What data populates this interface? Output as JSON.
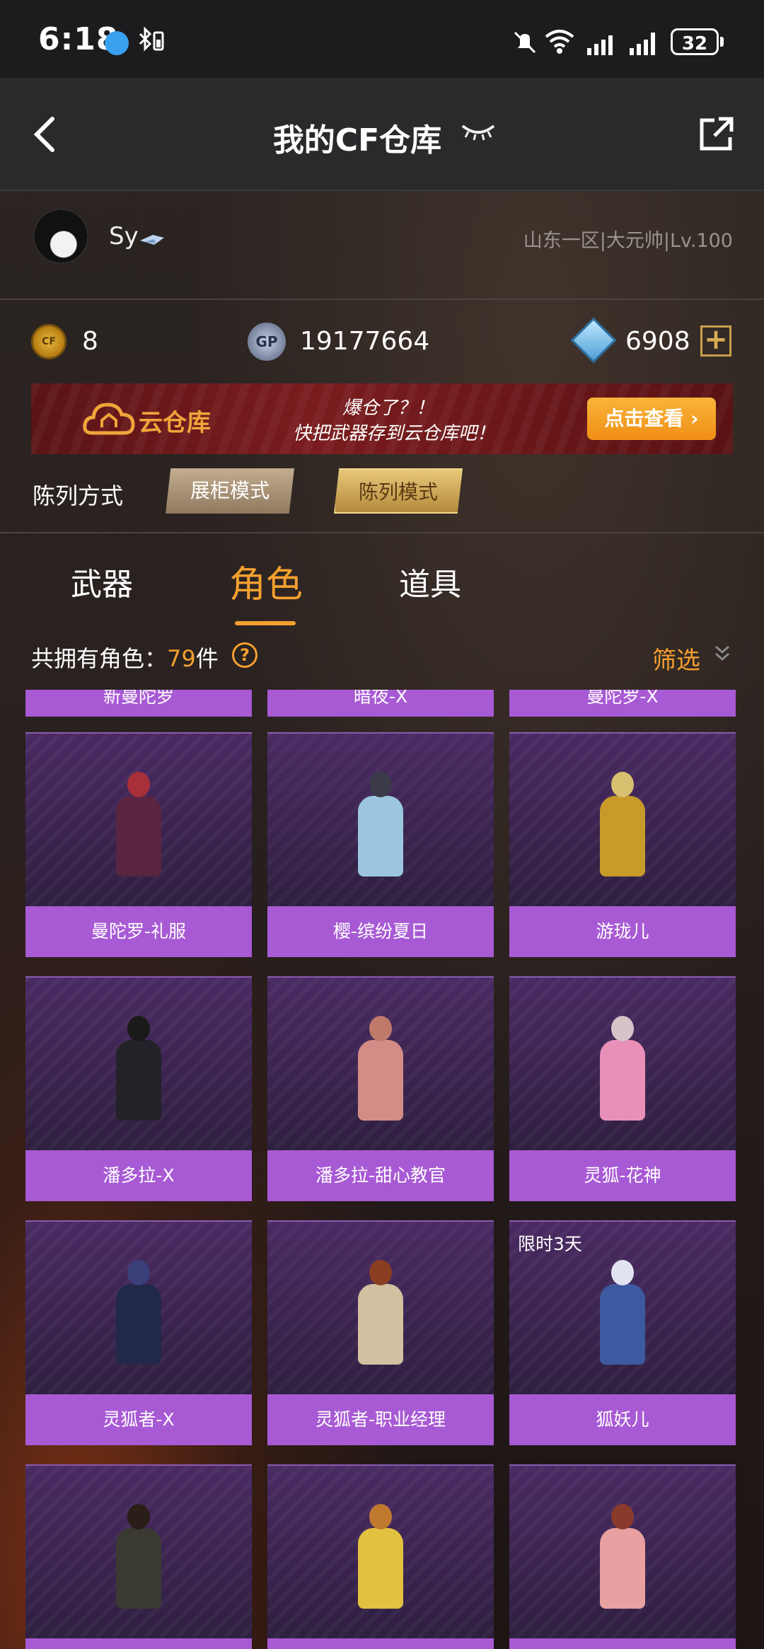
{
  "status_bar": {
    "time": "6:18",
    "battery": "32"
  },
  "header": {
    "title": "我的CF仓库"
  },
  "profile": {
    "username": "Sy",
    "server_info": "山东一区|大元帅|Lv.100"
  },
  "currencies": {
    "cf_points": "8",
    "gp": "19177664",
    "diamonds": "6908",
    "cf_icon_text": "CF",
    "gp_icon_text": "GP"
  },
  "banner": {
    "title": "云仓库",
    "slogan_1": "爆仓了？！",
    "slogan_2": "快把武器存到云仓库吧！",
    "button": "点击查看 ›"
  },
  "display_mode": {
    "label": "陈列方式",
    "options": [
      "展柜模式",
      "陈列模式"
    ],
    "selected": "陈列模式"
  },
  "tabs": [
    {
      "label": "武器"
    },
    {
      "label": "角色",
      "active": true
    },
    {
      "label": "道具"
    }
  ],
  "summary": {
    "prefix": "共拥有角色：",
    "count": "79",
    "suffix": "件",
    "help_icon": "?",
    "filter_label": "筛选"
  },
  "partial_top_row": [
    "新曼陀罗",
    "暗夜-X",
    "曼陀罗-X"
  ],
  "characters": [
    {
      "name": "曼陀罗-礼服",
      "hair": "#a8303a",
      "outfit": "#5a2540"
    },
    {
      "name": "樱-缤纷夏日",
      "hair": "#3a3a48",
      "outfit": "#9cc6e0"
    },
    {
      "name": "游珑儿",
      "hair": "#d8c070",
      "outfit": "#c79a2a"
    },
    {
      "name": "潘多拉-X",
      "hair": "#1a1a1a",
      "outfit": "#222228"
    },
    {
      "name": "潘多拉-甜心教官",
      "hair": "#c07a6a",
      "outfit": "#d48c86"
    },
    {
      "name": "灵狐-花神",
      "hair": "#d6c3c8",
      "outfit": "#e890b8"
    },
    {
      "name": "灵狐者-X",
      "hair": "#3a3f7a",
      "outfit": "#22284a"
    },
    {
      "name": "灵狐者-职业经理",
      "hair": "#8a3f22",
      "outfit": "#d2c0a0"
    },
    {
      "name": "狐妖儿",
      "hair": "#e0e4f0",
      "outfit": "#3d5aa0",
      "badge": "限时3天"
    },
    {
      "name": "",
      "hair": "#2a1e18",
      "outfit": "#3a3a32"
    },
    {
      "name": "",
      "hair": "#c07a30",
      "outfit": "#e2c040"
    },
    {
      "name": "",
      "hair": "#8a3a2a",
      "outfit": "#e8a0a0"
    }
  ]
}
